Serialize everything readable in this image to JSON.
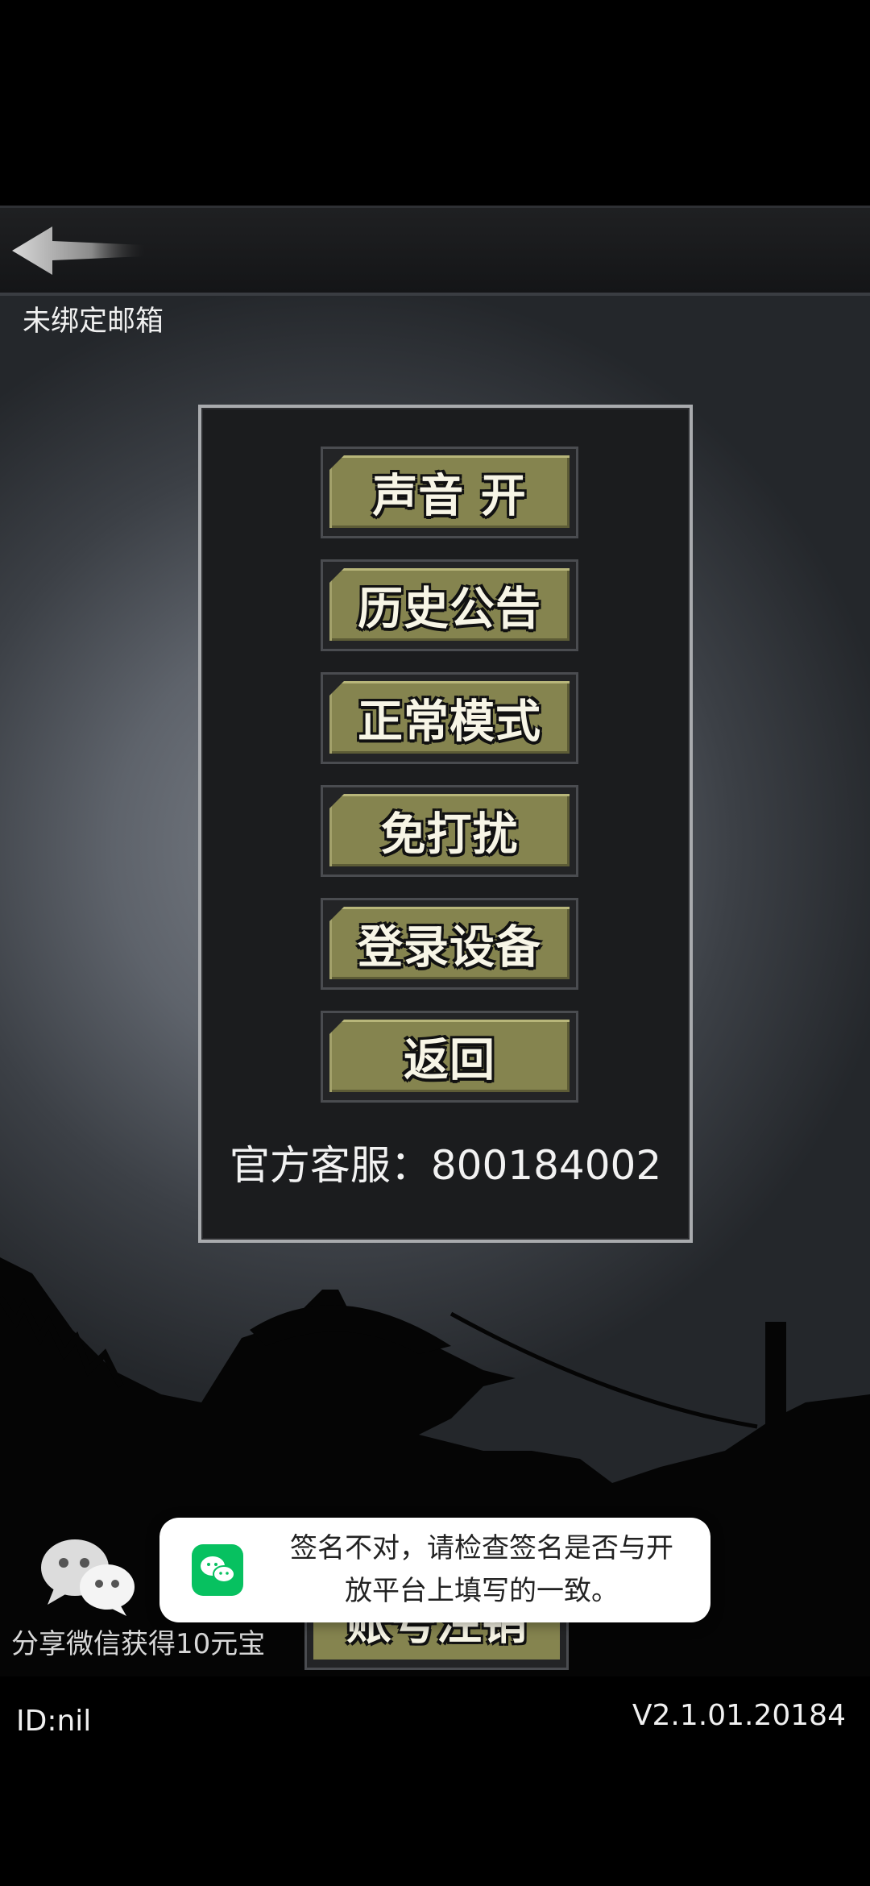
{
  "header": {
    "back_icon": "back-arrow-icon",
    "email_status": "未绑定邮箱"
  },
  "menu": {
    "items": [
      {
        "label": "声音 开"
      },
      {
        "label": "历史公告"
      },
      {
        "label": "正常模式"
      },
      {
        "label": "免打扰"
      },
      {
        "label": "登录设备"
      },
      {
        "label": "返回"
      }
    ],
    "customer_service": "官方客服：800184002"
  },
  "bottom": {
    "button_label": "账号注销",
    "share_icon": "wechat-icon",
    "share_label": "分享微信获得10元宝",
    "user_id": "ID:nil",
    "version": "V2.1.01.20184"
  },
  "toast": {
    "icon": "wechat-icon",
    "message_line1": "签名不对，请检查签名是否与开",
    "message_line2": "放平台上填写的一致。"
  },
  "colors": {
    "button_face": "#85844f",
    "wechat_green": "#07c160"
  }
}
